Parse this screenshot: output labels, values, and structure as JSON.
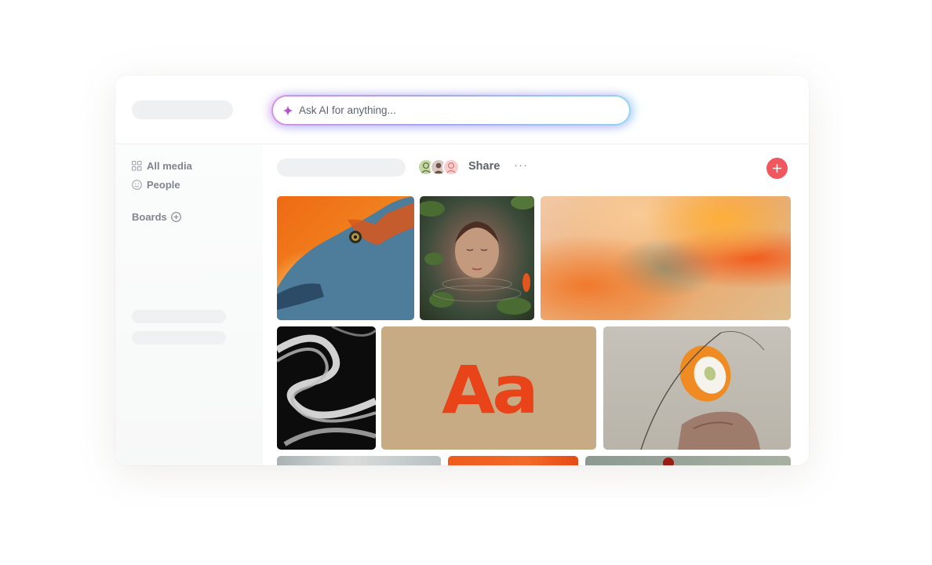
{
  "search": {
    "placeholder": "Ask AI for anything..."
  },
  "sidebar": {
    "items": [
      {
        "label": "All media",
        "icon": "grid-icon"
      },
      {
        "label": "People",
        "icon": "smiley-icon"
      }
    ],
    "boards_label": "Boards",
    "boards_add_icon": "plus-circle-icon"
  },
  "toolbar": {
    "share_label": "Share",
    "more_label": "···",
    "add_icon": "plus-icon"
  },
  "tiles": {
    "typography_sample": "Aa"
  },
  "colors": {
    "accent": "#f0575e",
    "ai_gradient_start": "#d78fe6",
    "ai_gradient_end": "#8fd6f4",
    "sparkle": "#c04fd1"
  }
}
